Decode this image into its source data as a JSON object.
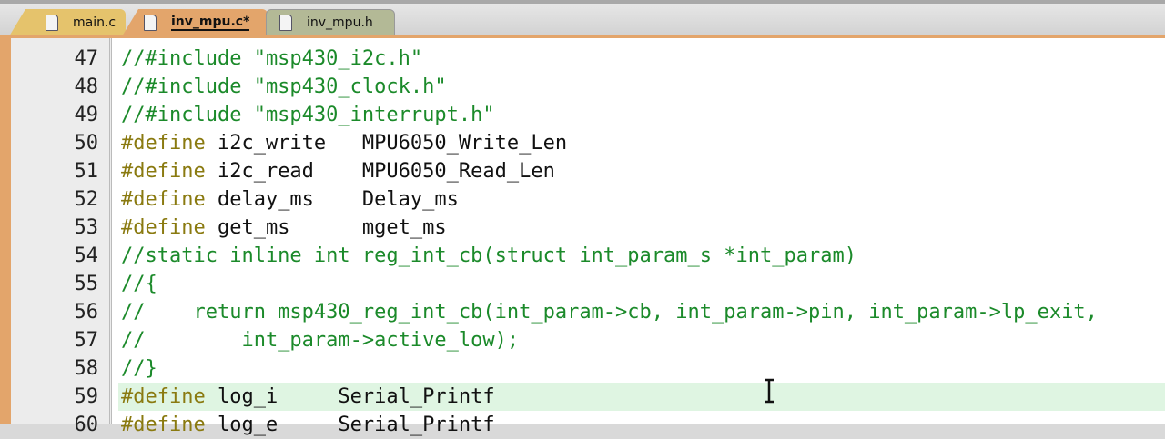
{
  "tabs": [
    {
      "label": "main.c",
      "active": false
    },
    {
      "label": "inv_mpu.c*",
      "active": true
    },
    {
      "label": "inv_mpu.h",
      "active": false
    }
  ],
  "lines": [
    {
      "num": "47",
      "parts": [
        {
          "t": "//#include \"msp430_i2c.h\"",
          "c": "cm"
        }
      ]
    },
    {
      "num": "48",
      "parts": [
        {
          "t": "//#include \"msp430_clock.h\"",
          "c": "cm"
        }
      ]
    },
    {
      "num": "49",
      "parts": [
        {
          "t": "//#include \"msp430_interrupt.h\"",
          "c": "cm"
        }
      ]
    },
    {
      "num": "50",
      "parts": [
        {
          "t": "#define",
          "c": "kw"
        },
        {
          "t": " i2c_write   MPU6050_Write_Len",
          "c": ""
        }
      ]
    },
    {
      "num": "51",
      "parts": [
        {
          "t": "#define",
          "c": "kw"
        },
        {
          "t": " i2c_read    MPU6050_Read_Len",
          "c": ""
        }
      ]
    },
    {
      "num": "52",
      "parts": [
        {
          "t": "#define",
          "c": "kw"
        },
        {
          "t": " delay_ms    Delay_ms",
          "c": ""
        }
      ]
    },
    {
      "num": "53",
      "parts": [
        {
          "t": "#define",
          "c": "kw"
        },
        {
          "t": " get_ms      mget_ms",
          "c": ""
        }
      ]
    },
    {
      "num": "54",
      "parts": [
        {
          "t": "//static inline int reg_int_cb(struct int_param_s *int_param)",
          "c": "cm"
        }
      ]
    },
    {
      "num": "55",
      "parts": [
        {
          "t": "//{",
          "c": "cm"
        }
      ]
    },
    {
      "num": "56",
      "parts": [
        {
          "t": "//    return msp430_reg_int_cb(int_param->cb, int_param->pin, int_param->lp_exit,",
          "c": "cm"
        }
      ]
    },
    {
      "num": "57",
      "parts": [
        {
          "t": "//        int_param->active_low);",
          "c": "cm"
        }
      ]
    },
    {
      "num": "58",
      "parts": [
        {
          "t": "//}",
          "c": "cm"
        }
      ]
    },
    {
      "num": "59",
      "highlight": true,
      "parts": [
        {
          "t": "#define",
          "c": "kw"
        },
        {
          "t": " log_i     Serial_Printf",
          "c": ""
        }
      ]
    },
    {
      "num": "60",
      "parts": [
        {
          "t": "#define",
          "c": "kw"
        },
        {
          "t": " log_e     Serial_Printf",
          "c": ""
        }
      ]
    }
  ]
}
